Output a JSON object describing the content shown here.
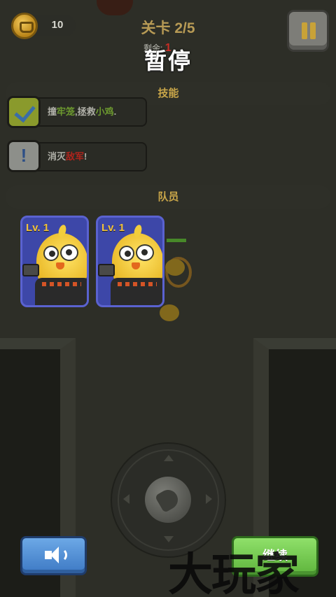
{
  "hud": {
    "coins": "10",
    "level": "关卡 2/5",
    "remaining_label": "剩余:",
    "remaining_value": "1"
  },
  "pause_title": "暂停",
  "sections": {
    "skills": "技能",
    "team": "队员"
  },
  "tasks": [
    {
      "prefix": "撞",
      "highlight1": "牢笼",
      "middle": ",拯救",
      "highlight2": "小鸡",
      "suffix": ".",
      "status": "complete"
    },
    {
      "prefix": "消灭",
      "highlight": "敌军",
      "suffix": "!",
      "status": "pending"
    }
  ],
  "team": [
    {
      "level_label": "Lv.",
      "level": "1"
    },
    {
      "level_label": "Lv.",
      "level": "1"
    }
  ],
  "buttons": {
    "continue": "继续",
    "sound_icon": "speaker-icon"
  },
  "watermark": "大玩家",
  "colors": {
    "level_text": "#b79a55",
    "section_title": "#c9a649",
    "card_bg": "#3d47a8",
    "continue_bg": "#5eb43c",
    "sound_bg": "#3d79c4",
    "pause_icon": "#c8a238"
  }
}
